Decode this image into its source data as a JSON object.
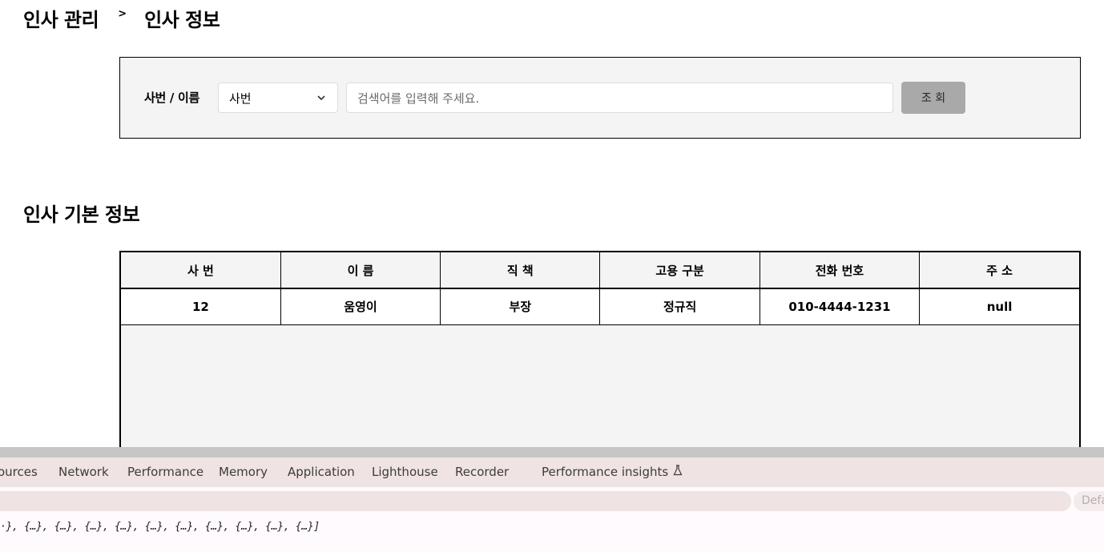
{
  "breadcrumb": {
    "parent": "인사 관리",
    "separator": ">",
    "current": "인사 정보"
  },
  "search": {
    "label": "사번 / 이름",
    "select_value": "사번",
    "input_placeholder": "검색어를 입력해 주세요.",
    "button_label": "조 회"
  },
  "section_title": "인사 기본 정보",
  "table": {
    "headers": [
      "사 번",
      "이 름",
      "직 책",
      "고용 구분",
      "전화 번호",
      "주 소"
    ],
    "rows": [
      [
        "12",
        "움영이",
        "부장",
        "정규직",
        "010-4444-1231",
        "null"
      ]
    ]
  },
  "devtools": {
    "tabs": [
      "ources",
      "Network",
      "Performance",
      "Memory",
      "Application",
      "Lighthouse",
      "Recorder",
      "Performance insights"
    ],
    "level_label": "Defa",
    "console_text": "·}, {…}, {…}, {…}, {…}, {…}, {…}, {…}, {…}, {…}, {…}]"
  }
}
